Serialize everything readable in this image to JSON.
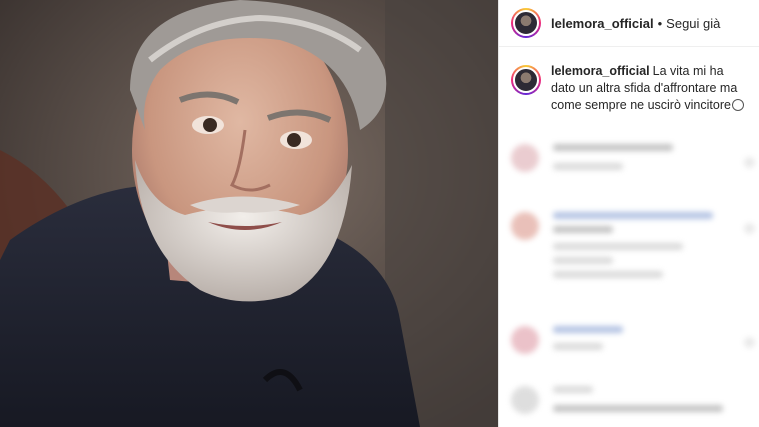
{
  "post": {
    "photo_alt": "portrait-photo"
  },
  "header": {
    "username": "lelemora_official",
    "separator": "•",
    "follow_label": "Segui già"
  },
  "caption": {
    "username": "lelemora_official",
    "text": "La vita mi ha dato un altra sfida d'affrontare ma come sempre ne uscirò vincitore"
  },
  "colors": {
    "text": "#262626",
    "avatar_ring": "#ee2a7b"
  }
}
